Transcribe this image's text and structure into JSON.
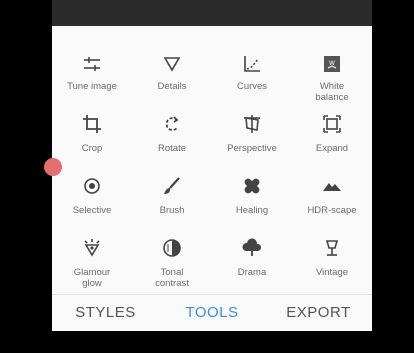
{
  "tools": [
    {
      "label": "Tune image",
      "icon": "tune-icon"
    },
    {
      "label": "Details",
      "icon": "triangle-icon"
    },
    {
      "label": "Curves",
      "icon": "curves-icon"
    },
    {
      "label": "White\nbalance",
      "icon": "white-balance-icon"
    },
    {
      "label": "Crop",
      "icon": "crop-icon"
    },
    {
      "label": "Rotate",
      "icon": "rotate-icon"
    },
    {
      "label": "Perspective",
      "icon": "perspective-icon"
    },
    {
      "label": "Expand",
      "icon": "expand-icon"
    },
    {
      "label": "Selective",
      "icon": "selective-icon"
    },
    {
      "label": "Brush",
      "icon": "brush-icon"
    },
    {
      "label": "Healing",
      "icon": "bandage-icon"
    },
    {
      "label": "HDR-scape",
      "icon": "mountain-icon"
    },
    {
      "label": "Glamour\nglow",
      "icon": "glamour-icon"
    },
    {
      "label": "Tonal\ncontrast",
      "icon": "tonal-contrast-icon"
    },
    {
      "label": "Drama",
      "icon": "cloud-icon"
    },
    {
      "label": "Vintage",
      "icon": "vintage-lamp-icon"
    }
  ],
  "tabs": [
    {
      "label": "STYLES",
      "active": false
    },
    {
      "label": "TOOLS",
      "active": true
    },
    {
      "label": "EXPORT",
      "active": false
    }
  ],
  "colors": {
    "accent": "#3b8fd9",
    "icon": "#444444",
    "label": "#6b6b6b"
  }
}
